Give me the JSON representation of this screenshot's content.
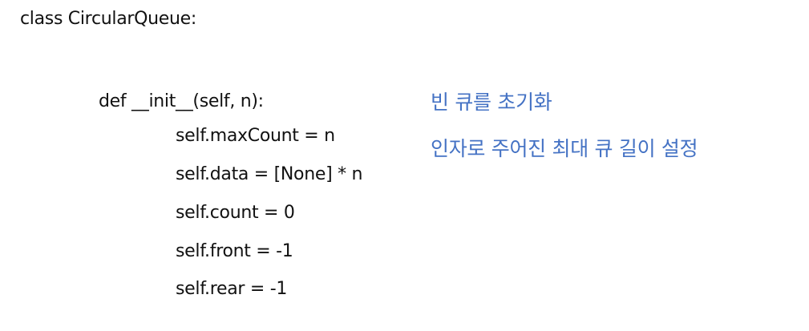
{
  "code": {
    "class_line": "class CircularQueue:",
    "def_line": "def __init__(self, n):",
    "body": [
      "self.maxCount = n",
      "self.data = [None] * n",
      "self.count = 0",
      "self.front = -1",
      "self.rear = -1"
    ]
  },
  "notes": [
    "빈 큐를 초기화",
    "인자로 주어진 최대 큐 길이 설정"
  ]
}
